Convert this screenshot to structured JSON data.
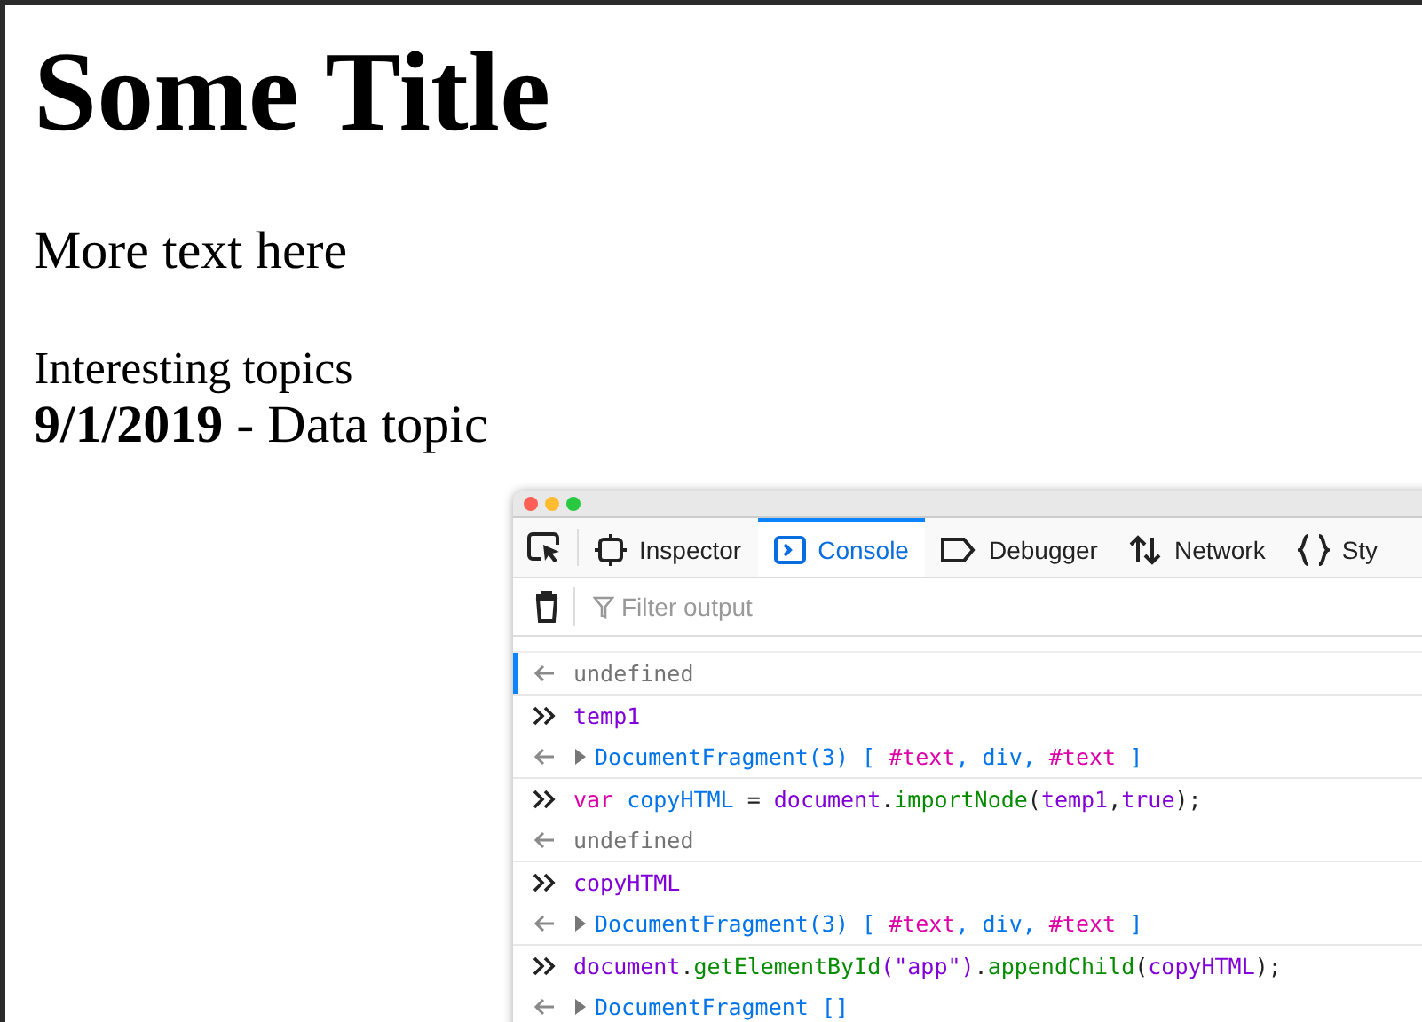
{
  "page": {
    "title": "Some Title",
    "paragraph": "More text here",
    "list_heading": "Interesting topics",
    "entry": "**9/1/2019** - Data topic"
  },
  "devtools": {
    "tabs": [
      {
        "label": "Inspector",
        "selected": false
      },
      {
        "label": "Console",
        "selected": true
      },
      {
        "label": "Debugger",
        "selected": false
      },
      {
        "label": "Network",
        "selected": false
      },
      {
        "label": "Sty",
        "selected": false
      }
    ],
    "filter": {
      "placeholder": "Filter output"
    },
    "console": [
      {
        "kind": "output",
        "selected": true,
        "tokens": [
          {
            "text": "undefined",
            "color": "#737373"
          }
        ]
      },
      {
        "kind": "input",
        "selected": false,
        "tokens": [
          {
            "text": "temp1",
            "color": "#8000d7"
          }
        ]
      },
      {
        "kind": "output",
        "selected": false,
        "expanded": false,
        "tokens": [
          {
            "text": "DocumentFragment(3) [ ",
            "color": "#0074e8"
          },
          {
            "text": "#text",
            "color": "#dd00a9"
          },
          {
            "text": ", div, ",
            "color": "#0074e8"
          },
          {
            "text": "#text",
            "color": "#dd00a9"
          },
          {
            "text": " ]",
            "color": "#0074e8"
          }
        ]
      },
      {
        "kind": "input",
        "selected": false,
        "tokens": [
          {
            "text": "var ",
            "color": "#dd00a9"
          },
          {
            "text": "copyHTML",
            "color": "#0074e8"
          },
          {
            "text": " = ",
            "color": "#222222"
          },
          {
            "text": "document",
            "color": "#8000d7"
          },
          {
            "text": ".",
            "color": "#222222"
          },
          {
            "text": "importNode",
            "color": "#058b00"
          },
          {
            "text": "(",
            "color": "#222222"
          },
          {
            "text": "temp1",
            "color": "#8000d7"
          },
          {
            "text": ",",
            "color": "#222222"
          },
          {
            "text": "true",
            "color": "#8000d7"
          },
          {
            "text": ");",
            "color": "#222222"
          }
        ]
      },
      {
        "kind": "output",
        "selected": false,
        "tokens": [
          {
            "text": "undefined",
            "color": "#737373"
          }
        ]
      },
      {
        "kind": "input",
        "selected": false,
        "tokens": [
          {
            "text": "copyHTML",
            "color": "#8000d7"
          }
        ]
      },
      {
        "kind": "output",
        "selected": false,
        "expanded": false,
        "tokens": [
          {
            "text": "DocumentFragment(3) [ ",
            "color": "#0074e8"
          },
          {
            "text": "#text",
            "color": "#dd00a9"
          },
          {
            "text": ", div, ",
            "color": "#0074e8"
          },
          {
            "text": "#text",
            "color": "#dd00a9"
          },
          {
            "text": " ]",
            "color": "#0074e8"
          }
        ]
      },
      {
        "kind": "input",
        "selected": false,
        "tokens": [
          {
            "text": "document",
            "color": "#8000d7"
          },
          {
            "text": ".",
            "color": "#222222"
          },
          {
            "text": "getElementById",
            "color": "#058b00"
          },
          {
            "text": "(\"app\")",
            "color": "#8000d7"
          },
          {
            "text": ".",
            "color": "#222222"
          },
          {
            "text": "appendChild",
            "color": "#058b00"
          },
          {
            "text": "(",
            "color": "#222222"
          },
          {
            "text": "copyHTML",
            "color": "#8000d7"
          },
          {
            "text": ");",
            "color": "#222222"
          }
        ]
      },
      {
        "kind": "output",
        "selected": false,
        "expanded": false,
        "tokens": [
          {
            "text": "DocumentFragment []",
            "color": "#0074e8"
          }
        ]
      }
    ]
  }
}
